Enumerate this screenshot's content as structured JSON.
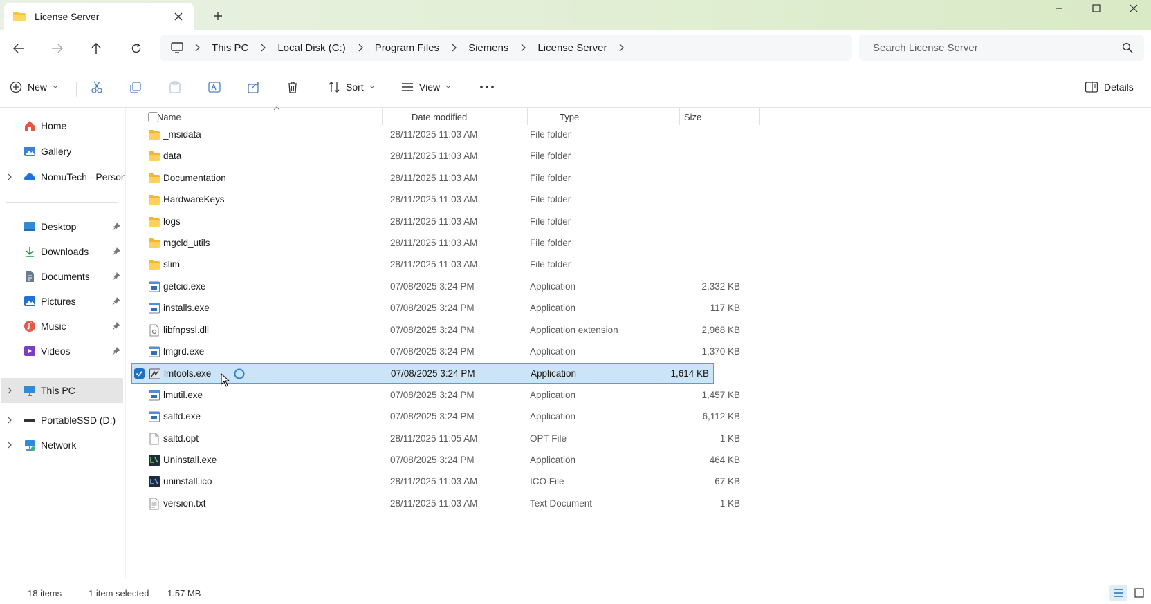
{
  "window": {
    "tab_title": "License Server"
  },
  "address": {
    "breadcrumbs": [
      "This PC",
      "Local Disk (C:)",
      "Program Files",
      "Siemens",
      "License Server"
    ],
    "search_placeholder": "Search License Server"
  },
  "toolbar": {
    "new_label": "New",
    "sort_label": "Sort",
    "view_label": "View",
    "details_label": "Details"
  },
  "sidebar": {
    "items": [
      {
        "label": "Home",
        "icon": "home-icon"
      },
      {
        "label": "Gallery",
        "icon": "gallery-icon"
      },
      {
        "label": "NomuTech - Personal",
        "icon": "cloud-icon"
      },
      {
        "label": "Desktop",
        "icon": "desktop-icon"
      },
      {
        "label": "Downloads",
        "icon": "download-icon"
      },
      {
        "label": "Documents",
        "icon": "documents-icon"
      },
      {
        "label": "Pictures",
        "icon": "pictures-icon"
      },
      {
        "label": "Music",
        "icon": "music-icon"
      },
      {
        "label": "Videos",
        "icon": "videos-icon"
      },
      {
        "label": "This PC",
        "icon": "pc-icon"
      },
      {
        "label": "PortableSSD (D:)",
        "icon": "drive-icon"
      },
      {
        "label": "Network",
        "icon": "network-icon"
      }
    ]
  },
  "columns": {
    "name": "Name",
    "date": "Date modified",
    "type": "Type",
    "size": "Size"
  },
  "files": [
    {
      "name": "_msidata",
      "date": "28/11/2025 11:03 AM",
      "type": "File folder",
      "size": "",
      "icon": "folder-icon"
    },
    {
      "name": "data",
      "date": "28/11/2025 11:03 AM",
      "type": "File folder",
      "size": "",
      "icon": "folder-icon"
    },
    {
      "name": "Documentation",
      "date": "28/11/2025 11:03 AM",
      "type": "File folder",
      "size": "",
      "icon": "folder-icon"
    },
    {
      "name": "HardwareKeys",
      "date": "28/11/2025 11:03 AM",
      "type": "File folder",
      "size": "",
      "icon": "folder-icon"
    },
    {
      "name": "logs",
      "date": "28/11/2025 11:03 AM",
      "type": "File folder",
      "size": "",
      "icon": "folder-icon"
    },
    {
      "name": "mgcld_utils",
      "date": "28/11/2025 11:03 AM",
      "type": "File folder",
      "size": "",
      "icon": "folder-icon"
    },
    {
      "name": "slim",
      "date": "28/11/2025 11:03 AM",
      "type": "File folder",
      "size": "",
      "icon": "folder-icon"
    },
    {
      "name": "getcid.exe",
      "date": "07/08/2025 3:24 PM",
      "type": "Application",
      "size": "2,332 KB",
      "icon": "app-icon"
    },
    {
      "name": "installs.exe",
      "date": "07/08/2025 3:24 PM",
      "type": "Application",
      "size": "117 KB",
      "icon": "app-icon"
    },
    {
      "name": "libfnpssl.dll",
      "date": "07/08/2025 3:24 PM",
      "type": "Application extension",
      "size": "2,968 KB",
      "icon": "dll-icon"
    },
    {
      "name": "lmgrd.exe",
      "date": "07/08/2025 3:24 PM",
      "type": "Application",
      "size": "1,370 KB",
      "icon": "app-icon"
    },
    {
      "name": "lmtools.exe",
      "date": "07/08/2025 3:24 PM",
      "type": "Application",
      "size": "1,614 KB",
      "icon": "lmtools-icon"
    },
    {
      "name": "lmutil.exe",
      "date": "07/08/2025 3:24 PM",
      "type": "Application",
      "size": "1,457 KB",
      "icon": "app-icon"
    },
    {
      "name": "saltd.exe",
      "date": "07/08/2025 3:24 PM",
      "type": "Application",
      "size": "6,112 KB",
      "icon": "app-icon"
    },
    {
      "name": "saltd.opt",
      "date": "28/11/2025 11:05 AM",
      "type": "OPT File",
      "size": "1 KB",
      "icon": "file-icon"
    },
    {
      "name": "Uninstall.exe",
      "date": "07/08/2025 3:24 PM",
      "type": "Application",
      "size": "464 KB",
      "icon": "uninstall-icon"
    },
    {
      "name": "uninstall.ico",
      "date": "28/11/2025 11:03 AM",
      "type": "ICO File",
      "size": "67 KB",
      "icon": "ico-icon"
    },
    {
      "name": "version.txt",
      "date": "28/11/2025 11:03 AM",
      "type": "Text Document",
      "size": "1 KB",
      "icon": "text-file-icon"
    }
  ],
  "status": {
    "count": "18 items",
    "selection": "1 item selected",
    "size": "1.57 MB"
  },
  "colors": {
    "accent": "#1f6fc5",
    "selection": "#cce4f7",
    "folder": "#f6c343"
  }
}
